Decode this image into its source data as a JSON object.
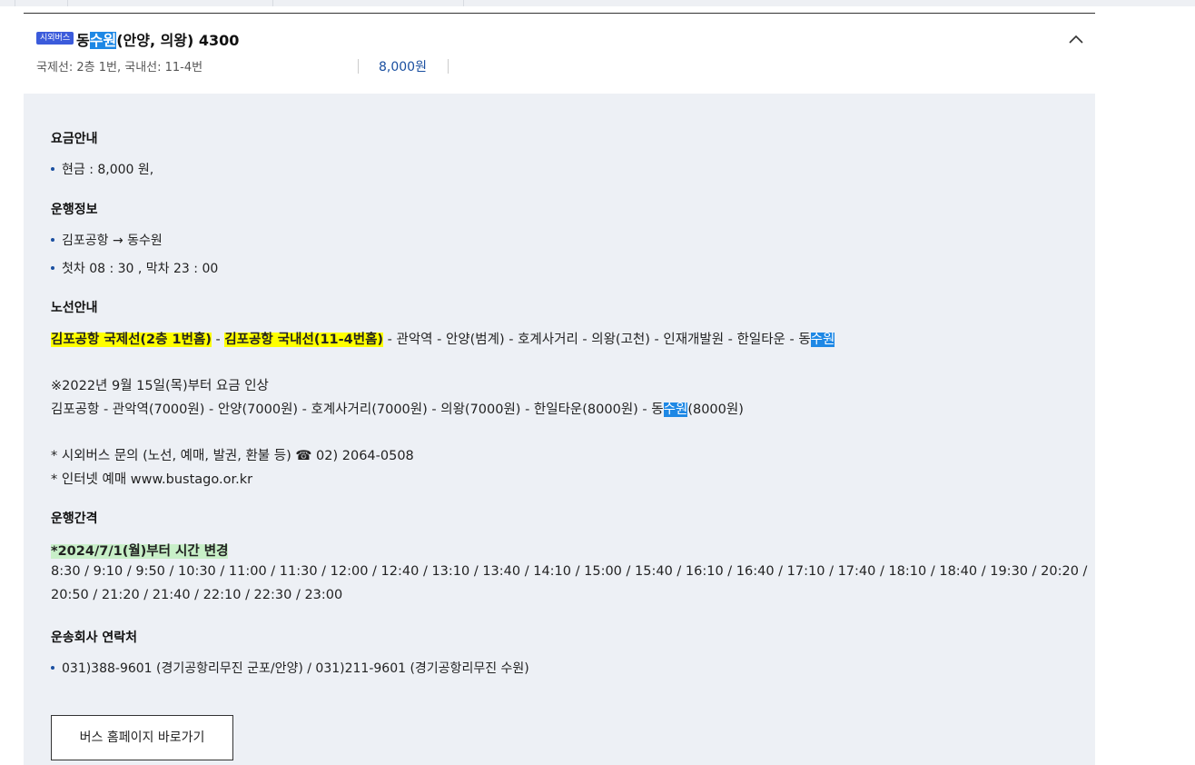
{
  "badge": "시외버스",
  "title": {
    "pre": "동",
    "hl": "수원",
    "post": "(안양, 의왕) 4300"
  },
  "meta": "국제선: 2층 1번, 국내선: 11-4번",
  "price": "8,000원",
  "fare": {
    "heading": "요금안내",
    "item": "현금 : 8,000 원,"
  },
  "operation": {
    "heading": "운행정보",
    "route": "김포공항 → 동수원",
    "times": "첫차 08 : 30 , 막차 23 : 00"
  },
  "route_info": {
    "heading": "노선안내",
    "stop1": "김포공항 국제선(2층 1번홈)",
    "sep1": " - ",
    "stop2": "김포공항 국내선(11-4번홈)",
    "rest": " - 관악역 - 안양(범계) - 호계사거리 - 의왕(고천) - 인재개발원 - 한일타운 - 동",
    "end_hl": "수원"
  },
  "notice": {
    "line1": "※2022년 9월 15일(목)부터 요금 인상",
    "line2_pre": "김포공항 - 관악역(7000원) - 안양(7000원) - 호계사거리(7000원) - 의왕(7000원) - 한일타운(8000원) - 동",
    "line2_hl": "수원",
    "line2_post": "(8000원)"
  },
  "contact_notes": {
    "line1": "* 시외버스 문의 (노선, 예매, 발권, 환불 등) ☎ 02) 2064-0508",
    "line2": "* 인터넷 예매 www.bustago.or.kr"
  },
  "interval": {
    "heading": "운행간격",
    "change": "*2024/7/1(월)부터 시간 변경",
    "line1": "8:30 / 9:10 / 9:50 / 10:30 / 11:00 / 11:30 / 12:00 / 12:40 / 13:10 / 13:40 / 14:10 / 15:00 / 15:40 / 16:10 / 16:40 / 17:10 / 17:40 / 18:10 / 18:40 / 19:30 / 20:20 /",
    "line2": "20:50 / 21:20 / 21:40 / 22:10 / 22:30 / 23:00"
  },
  "company": {
    "heading": "운송회사 연락처",
    "item": "031)388-9601 (경기공항리무진 군포/안양) / 031)211-9601 (경기공항리무진 수원)"
  },
  "button": "버스 홈페이지 바로가기"
}
